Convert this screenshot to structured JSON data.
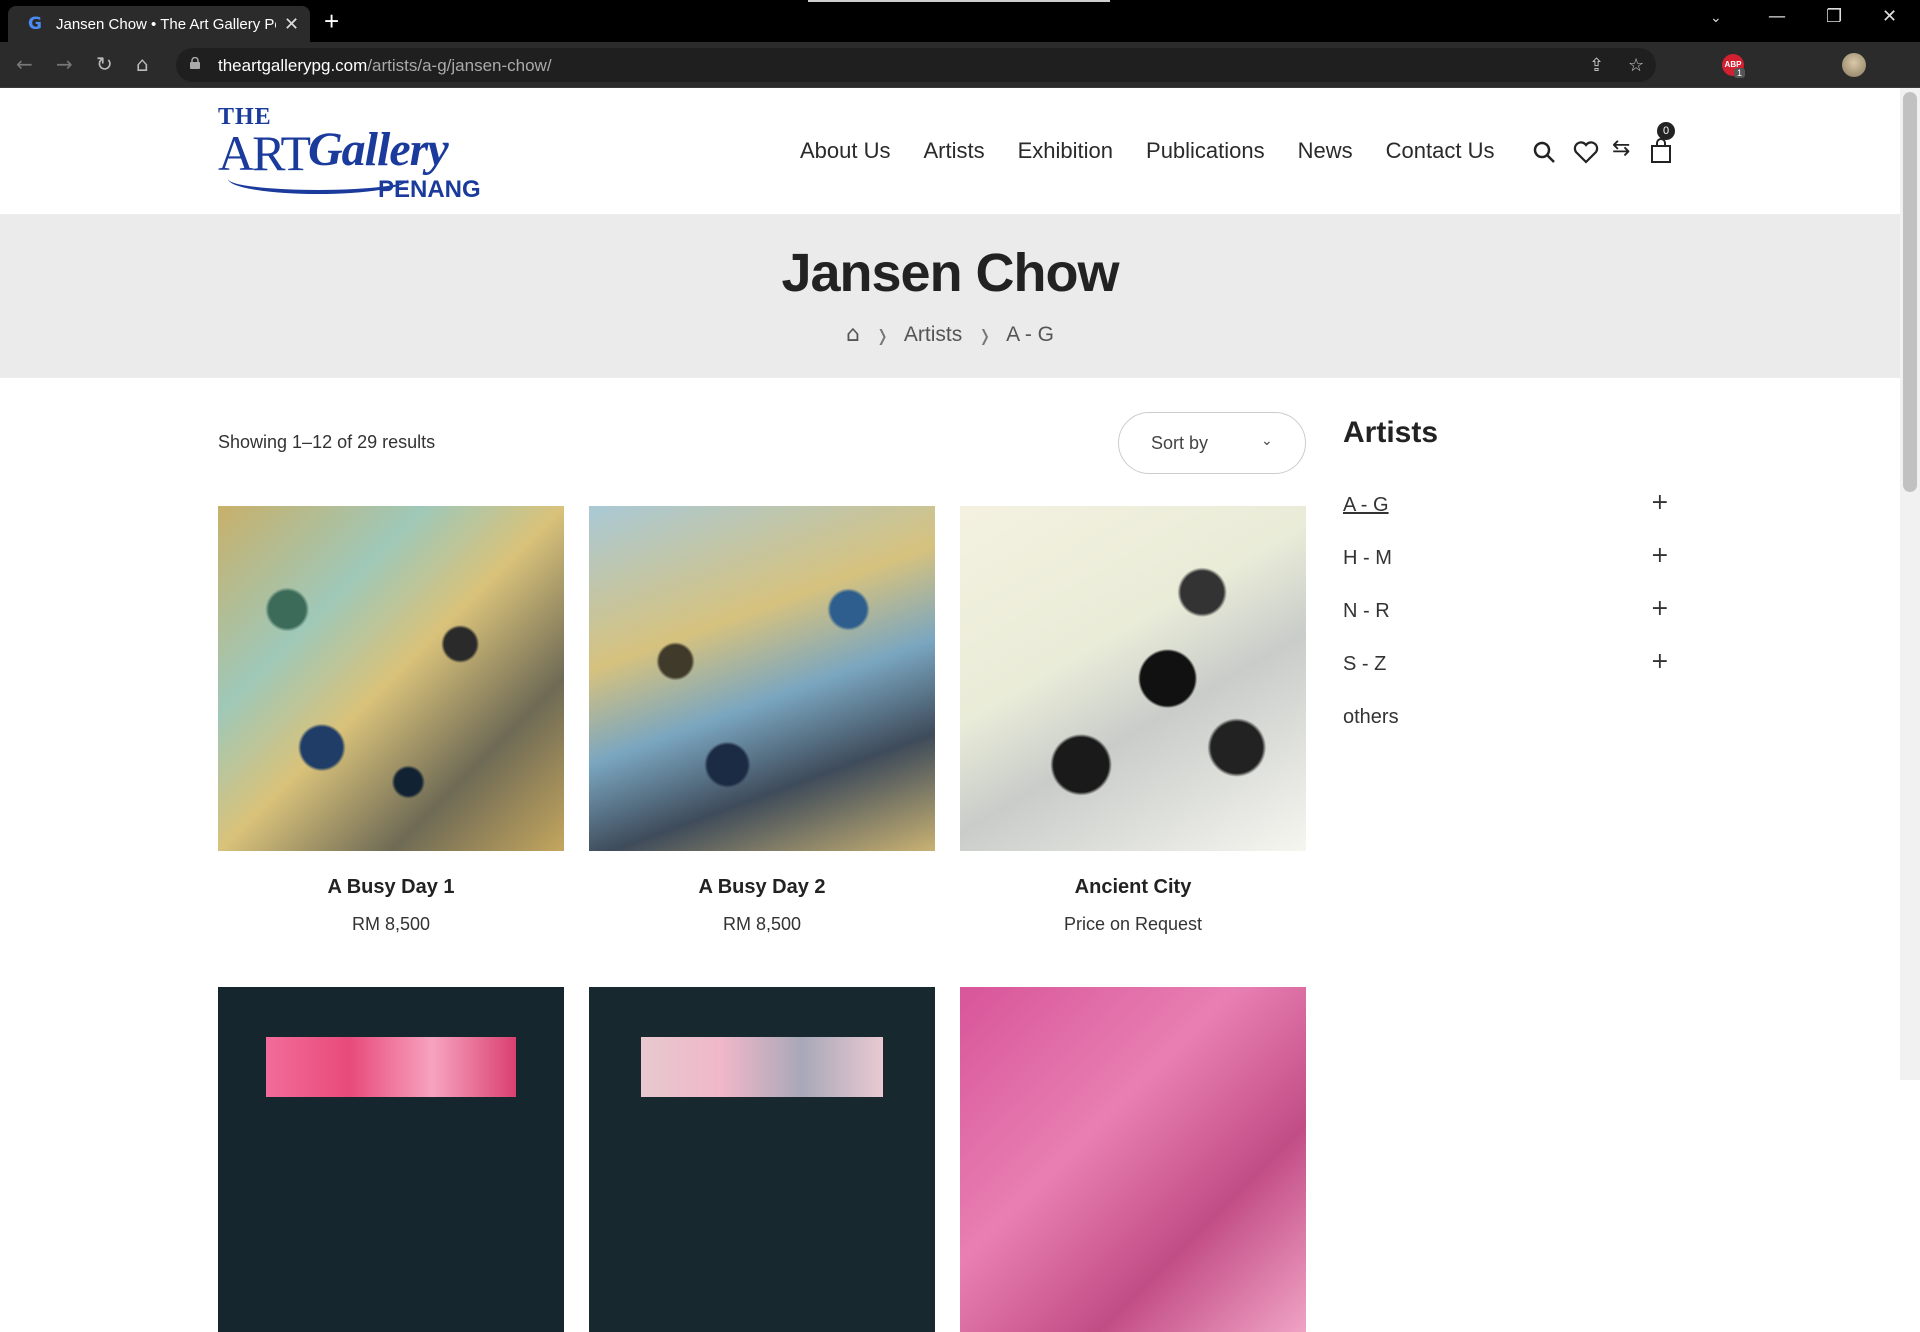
{
  "browser": {
    "tab_title": "Jansen Chow • The Art Gallery Pe",
    "tab_favicon": "G",
    "url_host": "theartgallerypg.com",
    "url_path": "/artists/a-g/jansen-chow/"
  },
  "header": {
    "logo": {
      "the": "THE",
      "art": "ART",
      "gallery": "Gallery",
      "penang": "PENANG"
    },
    "nav": [
      "About Us",
      "Artists",
      "Exhibition",
      "Publications",
      "News",
      "Contact Us"
    ],
    "cart_count": "0"
  },
  "page": {
    "title": "Jansen Chow",
    "breadcrumb": [
      "Artists",
      "A - G"
    ]
  },
  "shop": {
    "result_count": "Showing 1–12 of 29 results",
    "sort_label": "Sort by",
    "products": [
      {
        "name": "A Busy Day 1",
        "price": "RM 8,500"
      },
      {
        "name": "A Busy Day 2",
        "price": "RM 8,500"
      },
      {
        "name": "Ancient City",
        "price": "Price on Request"
      },
      {
        "name": "",
        "price": ""
      },
      {
        "name": "",
        "price": ""
      },
      {
        "name": "",
        "price": ""
      }
    ]
  },
  "sidebar": {
    "title": "Artists",
    "categories": [
      {
        "label": "A - G",
        "expand": "+"
      },
      {
        "label": "H - M",
        "expand": "+"
      },
      {
        "label": "N - R",
        "expand": "+"
      },
      {
        "label": "S - Z",
        "expand": "+"
      },
      {
        "label": "others",
        "expand": ""
      }
    ]
  },
  "colors": {
    "brand_blue": "#1a3a9c",
    "band_gray": "#ebebeb"
  }
}
